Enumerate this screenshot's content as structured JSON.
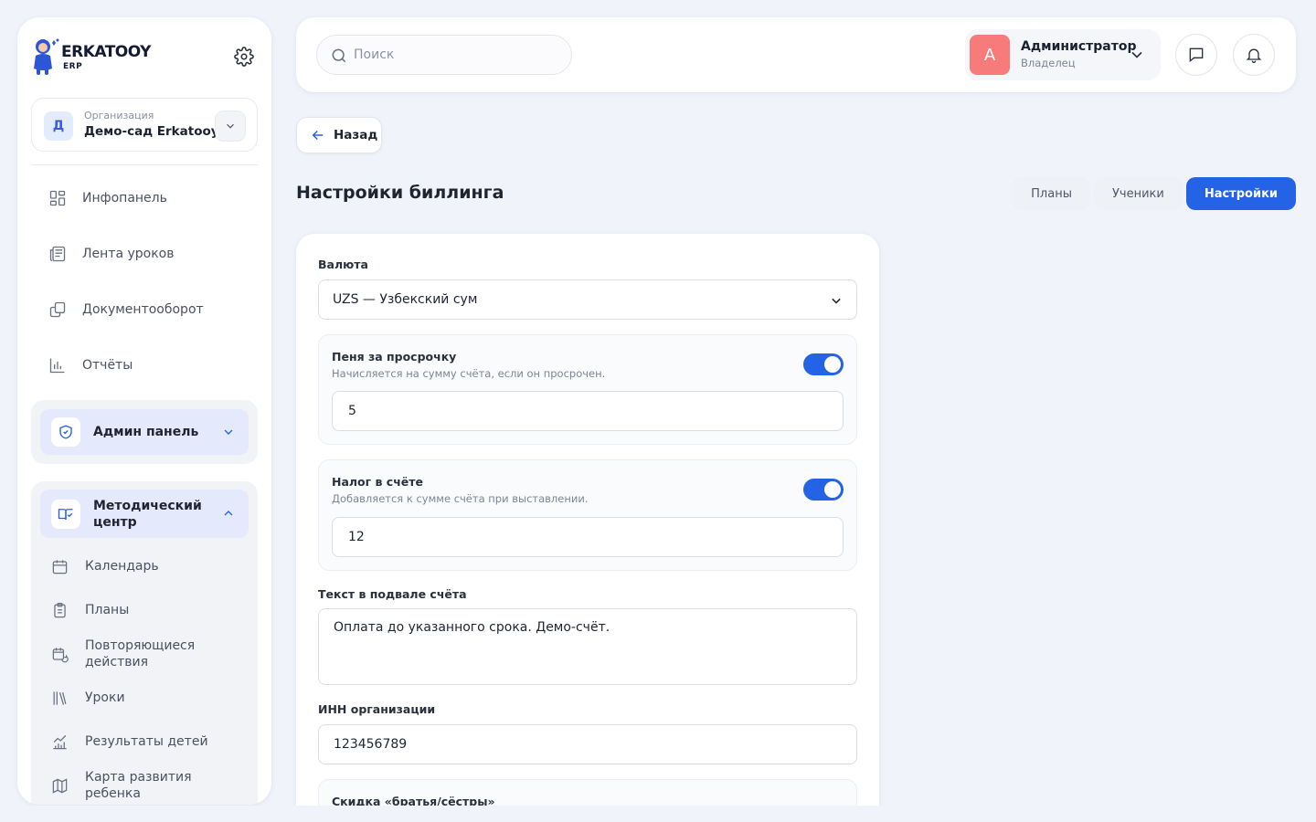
{
  "brand": {
    "name": "ERKATOOY",
    "sub": "ERP"
  },
  "org": {
    "label": "Организация",
    "name": "Демо-сад Erkatooy",
    "initial": "Д"
  },
  "nav": [
    {
      "label": "Инфопанель",
      "icon": "dashboard-icon"
    },
    {
      "label": "Лента уроков",
      "icon": "feed-icon"
    },
    {
      "label": "Документооборот",
      "icon": "documents-icon"
    },
    {
      "label": "Отчёты",
      "icon": "reports-icon"
    }
  ],
  "admin_group": {
    "label": "Админ панель"
  },
  "method_group": {
    "label": "Методический центр",
    "items": [
      {
        "label": "Календарь"
      },
      {
        "label": "Планы"
      },
      {
        "label": "Повторяющиеся действия"
      },
      {
        "label": "Уроки"
      },
      {
        "label": "Результаты детей"
      },
      {
        "label": "Карта развития ребенка"
      }
    ]
  },
  "search": {
    "placeholder": "Поиск"
  },
  "user": {
    "initial": "A",
    "name": "Администратор",
    "role": "Владелец"
  },
  "back": {
    "label": "Назад"
  },
  "page": {
    "title": "Настройки биллинга"
  },
  "tabs": [
    {
      "label": "Планы",
      "active": false
    },
    {
      "label": "Ученики",
      "active": false
    },
    {
      "label": "Настройки",
      "active": true
    }
  ],
  "form": {
    "currency_label": "Валюта",
    "currency_value": "UZS — Узбекский сум",
    "penalty": {
      "title": "Пеня за просрочку",
      "hint": "Начисляется на сумму счёта, если он просрочен.",
      "enabled": true,
      "value": "5"
    },
    "tax": {
      "title": "Налог в счёте",
      "hint": "Добавляется к сумме счёта при выставлении.",
      "enabled": true,
      "value": "12"
    },
    "footer_label": "Текст в подвале счёта",
    "footer_value": "Оплата до указанного срока. Демо-счёт.",
    "inn_label": "ИНН организации",
    "inn_value": "123456789",
    "sibling_title": "Скидка «братья/сёстры»"
  },
  "colors": {
    "accent": "#2462e6",
    "avatar": "#f77b7b",
    "background": "#f0f3fa"
  }
}
